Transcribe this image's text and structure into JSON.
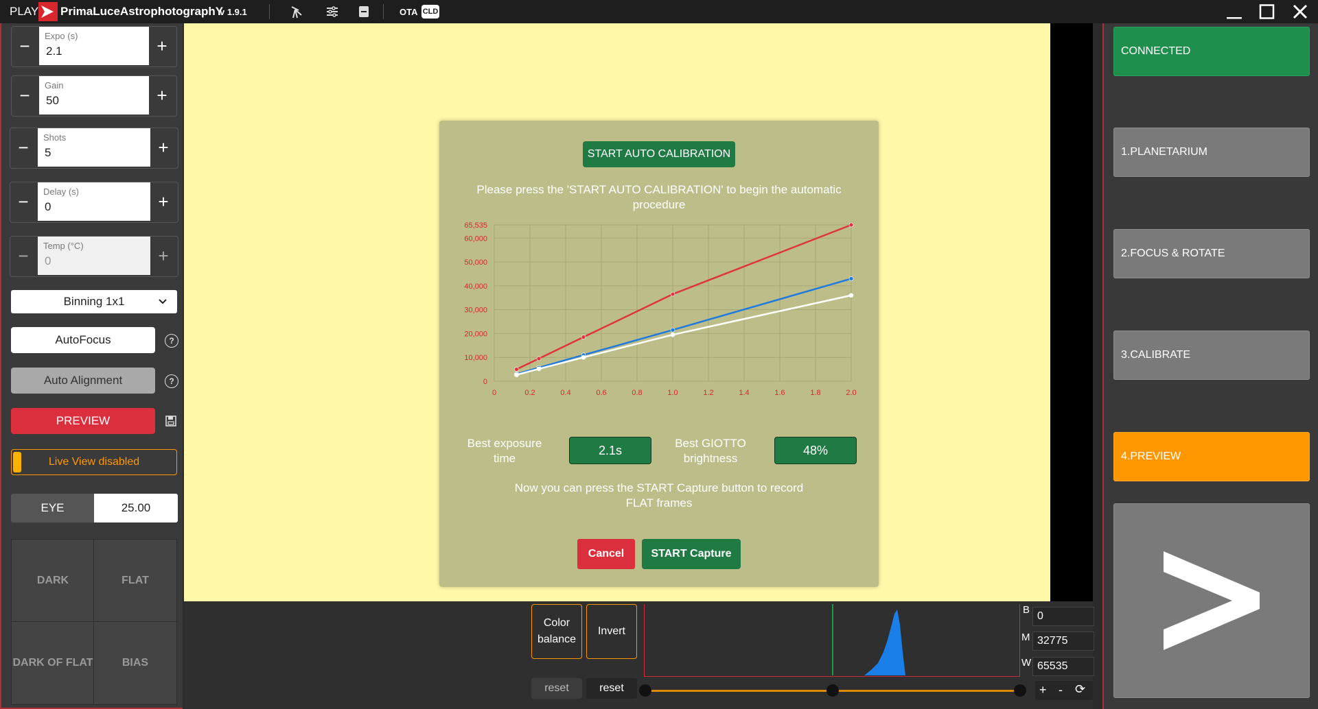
{
  "titlebar": {
    "play": "PLAY",
    "brand": "PrimaLuceAstrophotographY",
    "version": "v 1.9.1",
    "ota": "OTA",
    "cld": "CLD",
    "icons": [
      "telescope-icon",
      "sliders-icon",
      "battery-icon",
      "minimize-icon",
      "maximize-icon",
      "close-icon"
    ]
  },
  "left": {
    "expo": {
      "label": "Expo (s)",
      "value": "2.1"
    },
    "gain": {
      "label": "Gain",
      "value": "50"
    },
    "shots": {
      "label": "Shots",
      "value": "5"
    },
    "delay": {
      "label": "Delay (s)",
      "value": "0"
    },
    "temp": {
      "label": "Temp (°C)",
      "value": "0"
    },
    "minus": "−",
    "plus": "+",
    "binning": "Binning 1x1",
    "autofocus": "AutoFocus",
    "autoalign": "Auto Alignment",
    "preview": "PREVIEW",
    "liveview": "Live View disabled",
    "eye_label": "EYE",
    "eye_value": "25.00",
    "dark": "DARK",
    "flat": "FLAT",
    "dark_of_flat": "DARK OF FLAT",
    "bias": "BIAS"
  },
  "modal": {
    "start_auto": "START AUTO CALIBRATION",
    "instruction": "Please press the 'START AUTO CALIBRATION' to begin the automatic procedure",
    "best_exposure_label": "Best exposure time",
    "best_exposure_value": "2.1s",
    "best_brightness_label": "Best GIOTTO brightness",
    "best_brightness_value": "48%",
    "final_text": "Now you can press the START Capture button to record FLAT frames",
    "cancel": "Cancel",
    "start_capture": "START Capture"
  },
  "chart_data": {
    "type": "line",
    "x_ticks": [
      "0",
      "0.2",
      "0.4",
      "0.6",
      "0.8",
      "1.0",
      "1.2",
      "1.4",
      "1.6",
      "1.8",
      "2.0"
    ],
    "y_ticks": [
      "0",
      "10,000",
      "20,000",
      "30,000",
      "40,000",
      "50,000",
      "60,000",
      "65,535"
    ],
    "xlim": [
      0,
      2.0
    ],
    "ylim": [
      0,
      65535
    ],
    "grid": true,
    "series": [
      {
        "color": "#e0343d",
        "x": [
          0.125,
          0.25,
          0.5,
          1.0,
          2.0
        ],
        "y": [
          5000,
          9500,
          18500,
          36500,
          65535
        ]
      },
      {
        "color": "#1f7ae0",
        "x": [
          0.125,
          0.25,
          0.5,
          1.0,
          2.0
        ],
        "y": [
          3000,
          5700,
          11000,
          21500,
          43000
        ]
      },
      {
        "color": "#ffffff",
        "x": [
          0.125,
          0.25,
          0.5,
          1.0,
          2.0
        ],
        "y": [
          2700,
          5200,
          10000,
          19500,
          36000
        ]
      }
    ]
  },
  "bottom": {
    "color_balance": "Color balance",
    "invert": "Invert",
    "reset1": "reset",
    "reset2": "reset",
    "b_label": "B",
    "b_value": "0",
    "m_label": "M",
    "m_value": "32775",
    "w_label": "W",
    "w_value": "65535",
    "plus": "+",
    "minus": "-",
    "refresh": "⟳"
  },
  "right": {
    "connected": "CONNECTED",
    "planetarium": "1.PLANETARIUM",
    "focus": "2.FOCUS & ROTATE",
    "calibrate": "3.CALIBRATE",
    "preview": "4.PREVIEW",
    "next": ">"
  },
  "colors": {
    "accent_green": "#1f8f4e",
    "accent_orange": "#ff9800",
    "accent_red": "#dc2f3d",
    "modal_bg": "#bcbd88",
    "viewer_bg": "#fdf9a8"
  }
}
